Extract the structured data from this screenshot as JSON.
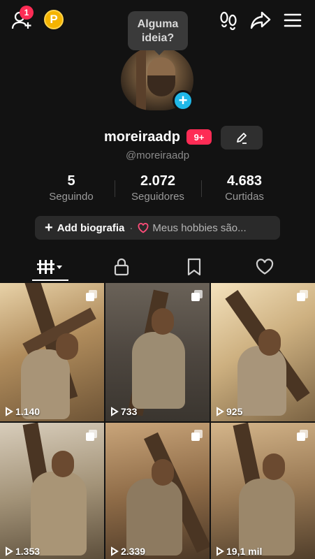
{
  "topbar": {
    "notification_count": "1",
    "coin_label": "P"
  },
  "tooltip": {
    "text": "Alguma ideia?"
  },
  "profile": {
    "username": "moreiraadp",
    "badge": "9+",
    "handle": "@moreiraadp"
  },
  "stats": [
    {
      "value": "5",
      "label": "Seguindo"
    },
    {
      "value": "2.072",
      "label": "Seguidores"
    },
    {
      "value": "4.683",
      "label": "Curtidas"
    }
  ],
  "bio": {
    "add_label": "Add biografia",
    "separator": "·",
    "hobby_text": "Meus hobbies são..."
  },
  "tabs": [
    {
      "icon": "grid-icon",
      "active": true
    },
    {
      "icon": "lock-icon",
      "active": false
    },
    {
      "icon": "bookmark-icon",
      "active": false
    },
    {
      "icon": "heart-icon",
      "active": false
    }
  ],
  "videos": [
    {
      "views": "1.140"
    },
    {
      "views": "733"
    },
    {
      "views": "925"
    },
    {
      "views": "1.353"
    },
    {
      "views": "2.339"
    },
    {
      "views": "19,1 mil"
    }
  ],
  "colors": {
    "background": "#121212",
    "accent_red": "#fe2c55",
    "accent_blue": "#20b8e8",
    "coin": "#f5b400"
  }
}
